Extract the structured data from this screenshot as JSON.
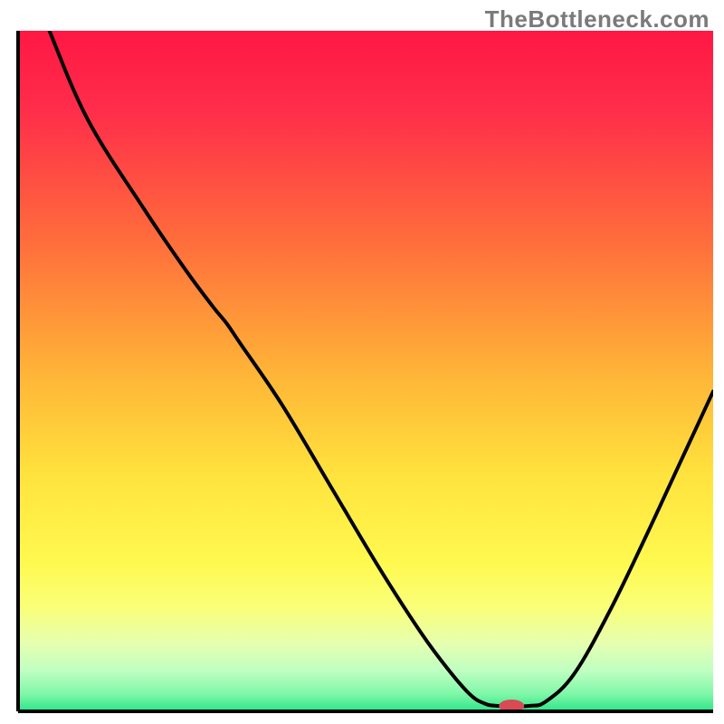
{
  "watermark": "TheBottleneck.com",
  "chart_data": {
    "type": "line",
    "title": "",
    "xlabel": "",
    "ylabel": "",
    "xlim": [
      0,
      100
    ],
    "ylim": [
      0,
      100
    ],
    "background_gradient": {
      "stops": [
        {
          "offset": 0.0,
          "color": "#ff1744"
        },
        {
          "offset": 0.12,
          "color": "#ff2e4a"
        },
        {
          "offset": 0.3,
          "color": "#ff6a3c"
        },
        {
          "offset": 0.5,
          "color": "#ffb337"
        },
        {
          "offset": 0.65,
          "color": "#ffe23d"
        },
        {
          "offset": 0.78,
          "color": "#fff94f"
        },
        {
          "offset": 0.85,
          "color": "#f9ff7a"
        },
        {
          "offset": 0.9,
          "color": "#e6ffb0"
        },
        {
          "offset": 0.94,
          "color": "#bfffc2"
        },
        {
          "offset": 0.975,
          "color": "#7EF7A8"
        },
        {
          "offset": 1.0,
          "color": "#2BE58A"
        }
      ]
    },
    "series": [
      {
        "name": "bottleneck-curve",
        "color": "#000000",
        "width": 4,
        "points": [
          {
            "x": 4.5,
            "y": 100.0
          },
          {
            "x": 10.0,
            "y": 87.0
          },
          {
            "x": 18.0,
            "y": 74.0
          },
          {
            "x": 24.0,
            "y": 65.0
          },
          {
            "x": 28.0,
            "y": 59.5
          },
          {
            "x": 30.0,
            "y": 57.0
          },
          {
            "x": 32.0,
            "y": 54.0
          },
          {
            "x": 38.0,
            "y": 45.0
          },
          {
            "x": 45.0,
            "y": 33.0
          },
          {
            "x": 52.0,
            "y": 21.0
          },
          {
            "x": 58.0,
            "y": 11.5
          },
          {
            "x": 62.0,
            "y": 6.0
          },
          {
            "x": 65.0,
            "y": 2.5
          },
          {
            "x": 67.0,
            "y": 1.2
          },
          {
            "x": 69.0,
            "y": 0.8
          },
          {
            "x": 73.5,
            "y": 0.8
          },
          {
            "x": 76.0,
            "y": 1.5
          },
          {
            "x": 80.0,
            "y": 5.5
          },
          {
            "x": 85.0,
            "y": 14.5
          },
          {
            "x": 90.0,
            "y": 25.0
          },
          {
            "x": 95.0,
            "y": 36.0
          },
          {
            "x": 100.0,
            "y": 47.0
          }
        ]
      }
    ],
    "marker": {
      "name": "optimal-point",
      "x": 71,
      "y": 0.8,
      "color": "#d94a55",
      "rx": 14,
      "ry": 7
    },
    "axes": {
      "color": "#000000",
      "width": 4
    }
  }
}
